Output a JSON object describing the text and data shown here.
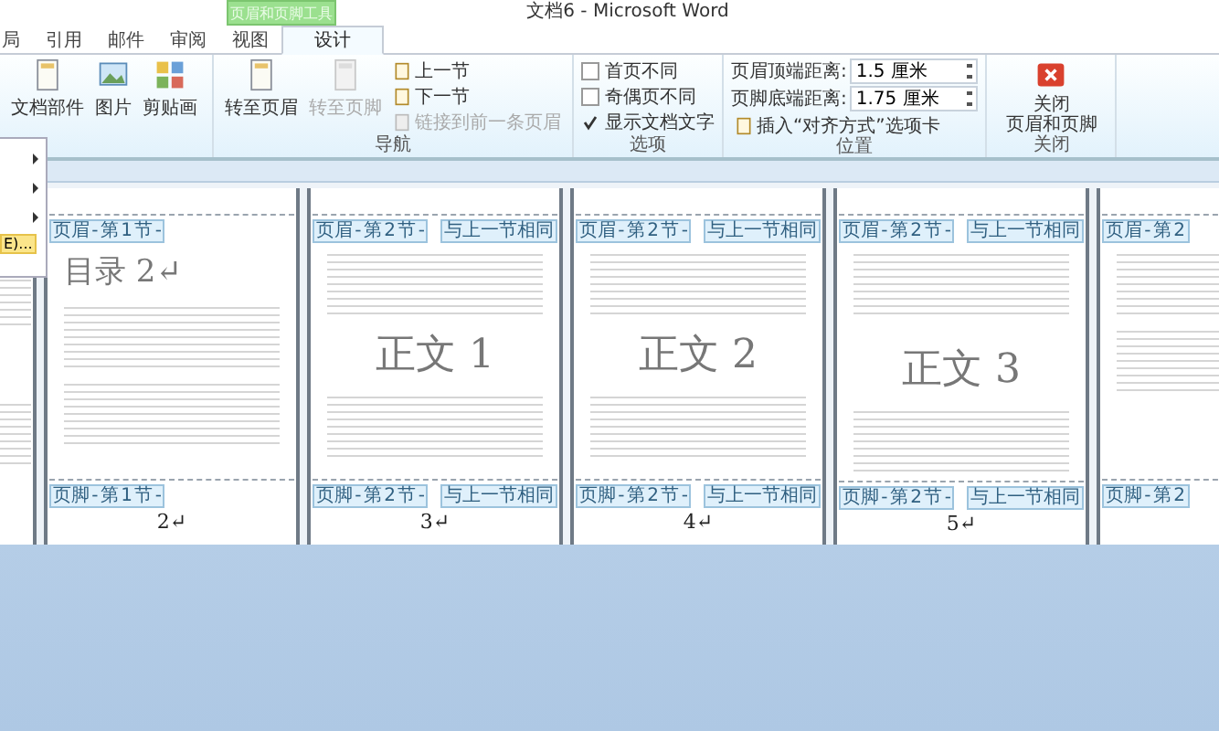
{
  "window": {
    "title": "文档6 - Microsoft Word",
    "context_tab_title": "页眉和页脚工具"
  },
  "tabs": [
    {
      "label": "局",
      "selected": false
    },
    {
      "label": "引用",
      "selected": false
    },
    {
      "label": "邮件",
      "selected": false
    },
    {
      "label": "审阅",
      "selected": false
    },
    {
      "label": "视图",
      "selected": false
    },
    {
      "label": "设计",
      "selected": true
    }
  ],
  "ribbon_groups": [
    {
      "items": [
        {
          "kind": "large",
          "label": "文档部件",
          "disabled": false
        },
        {
          "kind": "large",
          "label": "图片",
          "disabled": false
        },
        {
          "kind": "large",
          "label": "剪贴画",
          "disabled": false
        }
      ]
    },
    {
      "label": "导航",
      "items": [
        {
          "kind": "large",
          "label": "转至页眉",
          "disabled": false
        },
        {
          "kind": "large",
          "label": "转至页脚",
          "disabled": true
        },
        {
          "kind": "small",
          "label": "上一节",
          "disabled": false
        },
        {
          "kind": "small",
          "label": "下一节",
          "disabled": false
        },
        {
          "kind": "small",
          "label": "链接到前一条页眉",
          "disabled": true
        }
      ]
    },
    {
      "label": "选项",
      "items": [
        {
          "kind": "checkbox",
          "label": "首页不同",
          "checked": false
        },
        {
          "kind": "checkbox",
          "label": "奇偶页不同",
          "checked": false
        },
        {
          "kind": "checkbox",
          "label": "显示文档文字",
          "checked": true
        }
      ]
    },
    {
      "label": "位置",
      "items": [
        {
          "kind": "spin",
          "label": "页眉顶端距离:",
          "value": "1.5 厘米"
        },
        {
          "kind": "spin",
          "label": "页脚底端距离:",
          "value": "1.75 厘米"
        },
        {
          "kind": "small",
          "label": "插入“对齐方式”选项卡",
          "disabled": false
        }
      ]
    },
    {
      "label": "关闭",
      "items": [
        {
          "kind": "close",
          "label_lines": [
            "关闭",
            "页眉和页脚"
          ]
        }
      ]
    }
  ],
  "dropdown_menu": {
    "highlighted_item": "E)..."
  },
  "pages": [
    {
      "kind": "partial"
    },
    {
      "kind": "page",
      "header": "页眉 - 第 1 节 -",
      "heading": "目录 2↵",
      "footer": "页脚 - 第 1 节 -",
      "number": "2↵"
    },
    {
      "kind": "page",
      "header": "页眉 - 第 2 节 -",
      "header_same": "与上一节相同",
      "heading": "正文 1",
      "footer": "页脚 - 第 2 节 -",
      "footer_same": "与上一节相同",
      "number": "3↵"
    },
    {
      "kind": "page",
      "header": "页眉 - 第 2 节 -",
      "header_same": "与上一节相同",
      "heading": "正文 2",
      "footer": "页脚 - 第 2 节 -",
      "footer_same": "与上一节相同",
      "number": "4↵"
    },
    {
      "kind": "page",
      "header": "页眉 - 第 2 节 -",
      "header_same": "与上一节相同",
      "heading": "正文 3",
      "footer": "页脚 - 第 2 节 -",
      "footer_same": "与上一节相同",
      "number": "5↵"
    },
    {
      "kind": "page",
      "header": "页眉 - 第 2",
      "footer": "页脚 - 第 2"
    }
  ]
}
